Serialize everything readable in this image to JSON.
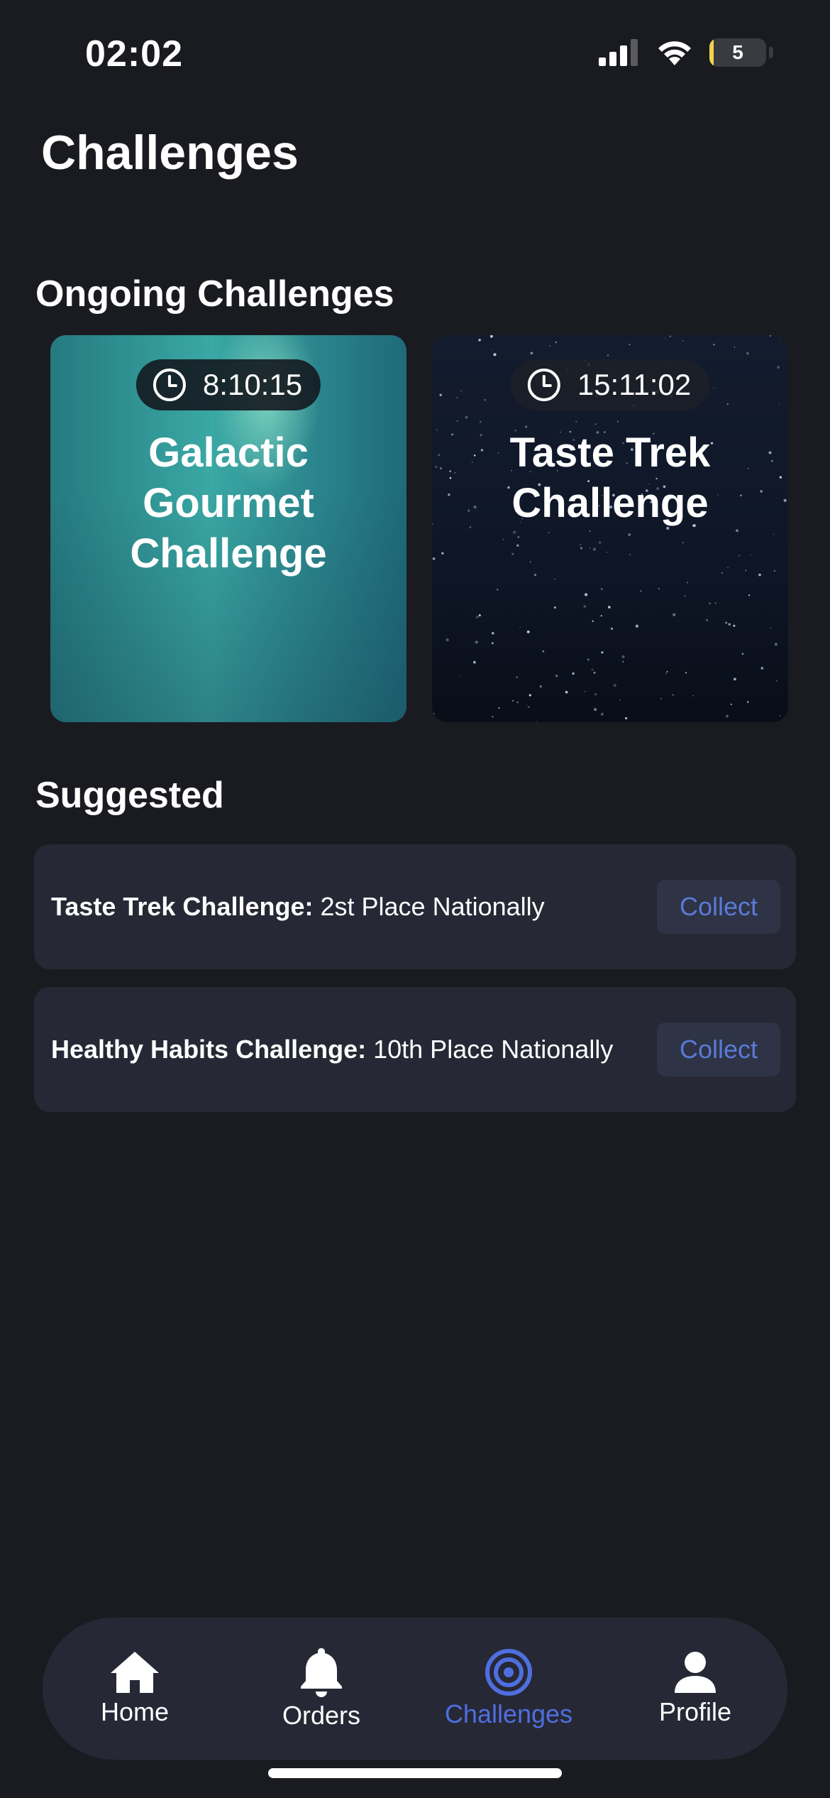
{
  "status_bar": {
    "time": "02:02",
    "battery_level": "5",
    "battery_fraction": 0.05
  },
  "page_title": "Challenges",
  "ongoing": {
    "title": "Ongoing Challenges",
    "cards": [
      {
        "timer": "8:10:15",
        "title": "Galactic Gourmet Challenge",
        "icon": "clock-icon"
      },
      {
        "timer": "15:11:02",
        "title": "Taste Trek Challenge",
        "icon": "clock-icon"
      }
    ]
  },
  "suggested": {
    "title": "Suggested",
    "items": [
      {
        "name": "Taste Trek Challenge:",
        "detail": "2st Place Nationally",
        "action": "Collect"
      },
      {
        "name": "Healthy Habits Challenge:",
        "detail": "10th Place Nationally",
        "action": "Collect"
      }
    ]
  },
  "tab_bar": {
    "tabs": [
      {
        "label": "Home",
        "icon": "home-icon"
      },
      {
        "label": "Orders",
        "icon": "bell-icon"
      },
      {
        "label": "Challenges",
        "icon": "target-icon",
        "active": true
      },
      {
        "label": "Profile",
        "icon": "person-icon"
      }
    ]
  },
  "colors": {
    "background": "#1a1b20",
    "surface": "#262835",
    "accent": "#4f6fe0",
    "collect_text": "#5a7ad6",
    "battery": "#f1d44c"
  }
}
